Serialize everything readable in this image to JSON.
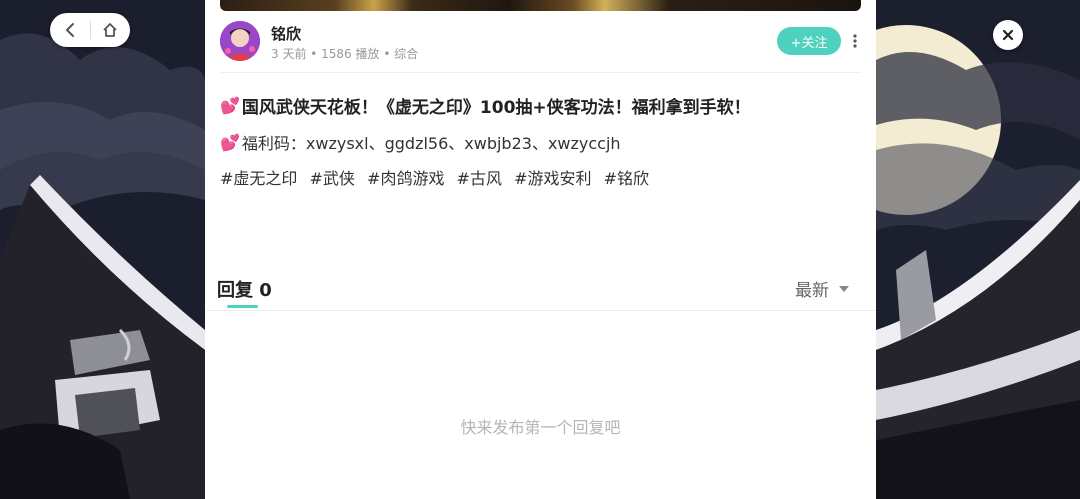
{
  "nav": {
    "back_icon": "chevron-left-icon",
    "home_icon": "home-icon",
    "close_icon": "close-icon"
  },
  "author": {
    "name": "铭欣",
    "meta": "3 天前 • 1586 播放 • 综合",
    "follow_label": "+关注",
    "more_icon": "more-vertical-icon"
  },
  "post": {
    "title_icon": "heart-icon",
    "title": "国风武侠天花板！《虚无之印》100抽+侠客功法！福利拿到手软！",
    "code_line": "福利码：xwzysxl、ggdzl56、xwbjb23、xwzyccjh",
    "tags": [
      "#虚无之印",
      "#武侠",
      "#肉鸽游戏",
      "#古风",
      "#游戏安利",
      "#铭欣"
    ]
  },
  "replies": {
    "header": "回复 0",
    "sort_label": "最新",
    "empty_text": "快来发布第一个回复吧"
  },
  "colors": {
    "accent": "#4fd1c0",
    "heart": "#ff3d7f",
    "text_primary": "#222222",
    "text_muted": "#999999"
  }
}
